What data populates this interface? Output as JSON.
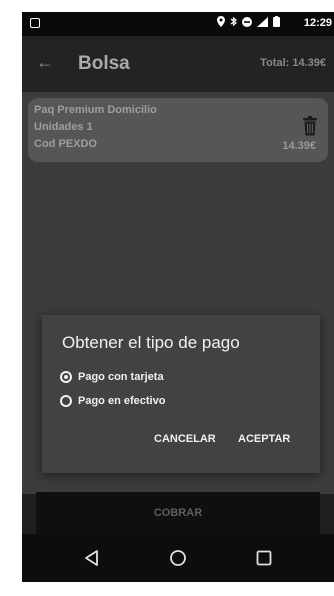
{
  "status_bar": {
    "time": "12:29",
    "icons": [
      "location-icon",
      "bluetooth-icon",
      "do-not-disturb-icon",
      "signal-icon",
      "battery-icon"
    ]
  },
  "app_bar": {
    "title": "Bolsa",
    "total": "Total: 14.39€"
  },
  "cart_item": {
    "name": "Paq Premium Domicilio",
    "units": "Unidades 1",
    "code": "Cod PEXDO",
    "price": "14.39€"
  },
  "dialog": {
    "title": "Obtener el tipo de pago",
    "options": [
      {
        "label": "Pago con tarjeta",
        "selected": true
      },
      {
        "label": "Pago en efectivo",
        "selected": false
      }
    ],
    "cancel_label": "CANCELAR",
    "accept_label": "ACEPTAR"
  },
  "checkout_button": {
    "label": "COBRAR"
  },
  "colors": {
    "dialog_bg": "#424242",
    "scrim": "#3c3c3c",
    "card_bg": "#565656"
  }
}
